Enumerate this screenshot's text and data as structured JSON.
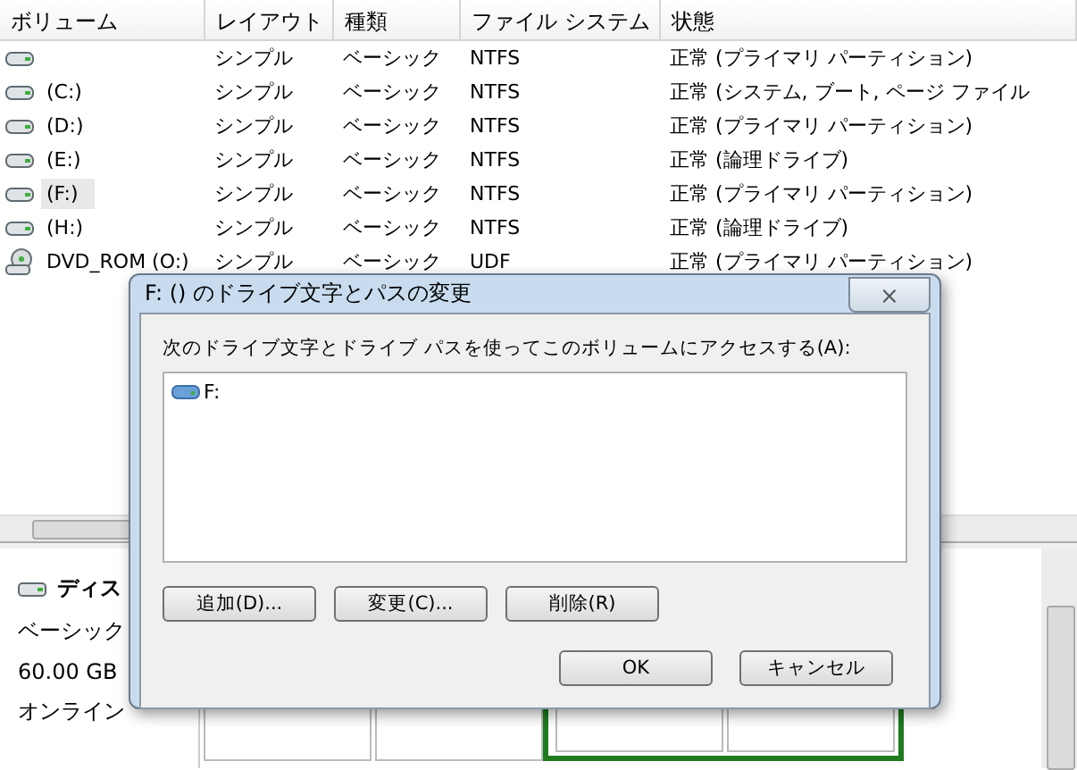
{
  "volume_list": {
    "columns": [
      "ボリューム",
      "レイアウト",
      "種類",
      "ファイル システム",
      "状態"
    ],
    "rows": [
      {
        "kind": "hdd",
        "cells": [
          "",
          "シンプル",
          "ベーシック",
          "NTFS",
          "正常 (プライマリ パーティション)"
        ],
        "selected": false
      },
      {
        "kind": "hdd",
        "cells": [
          "(C:)",
          "シンプル",
          "ベーシック",
          "NTFS",
          "正常 (システム, ブート, ページ ファイル"
        ],
        "selected": false
      },
      {
        "kind": "hdd",
        "cells": [
          "(D:)",
          "シンプル",
          "ベーシック",
          "NTFS",
          "正常 (プライマリ パーティション)"
        ],
        "selected": false
      },
      {
        "kind": "hdd",
        "cells": [
          "(E:)",
          "シンプル",
          "ベーシック",
          "NTFS",
          "正常 (論理ドライブ)"
        ],
        "selected": false
      },
      {
        "kind": "hdd",
        "cells": [
          "(F:)",
          "シンプル",
          "ベーシック",
          "NTFS",
          "正常 (プライマリ パーティション)"
        ],
        "selected": true
      },
      {
        "kind": "hdd",
        "cells": [
          "(H:)",
          "シンプル",
          "ベーシック",
          "NTFS",
          "正常 (論理ドライブ)"
        ],
        "selected": false
      },
      {
        "kind": "dvd",
        "cells": [
          "DVD_ROM (O:)",
          "シンプル",
          "ベーシック",
          "UDF",
          "正常 (プライマリ パーティション)"
        ],
        "selected": false
      }
    ]
  },
  "disk": {
    "name": "ディス",
    "type": "ベーシック",
    "size": "60.00 GB",
    "status": "オンライン"
  },
  "dialog": {
    "title": "F: () のドライブ文字とパスの変更",
    "close": "⨯",
    "label": "次のドライブ文字とドライブ パスを使ってこのボリュームにアクセスする(A):",
    "paths": [
      {
        "name": "F:"
      }
    ],
    "buttons": [
      "追加(D)...",
      "変更(C)...",
      "削除(R)"
    ],
    "ok": "OK",
    "cancel": "キャンセル"
  }
}
